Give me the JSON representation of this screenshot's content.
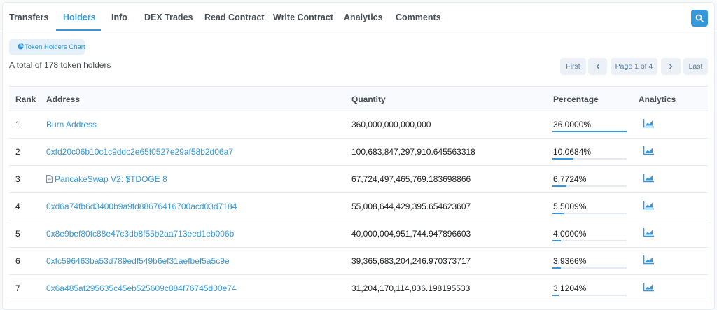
{
  "tabs": [
    {
      "label": "Transfers",
      "active": false
    },
    {
      "label": "Holders",
      "active": true
    },
    {
      "label": "Info",
      "active": false
    },
    {
      "label": "DEX Trades",
      "active": false
    },
    {
      "label": "Read Contract",
      "active": false
    },
    {
      "label": "Write Contract",
      "active": false
    },
    {
      "label": "Analytics",
      "active": false
    },
    {
      "label": "Comments",
      "active": false
    }
  ],
  "chart_button_label": "Token Holders Chart",
  "total_text": "A total of 178 token holders",
  "pagination": {
    "first": "First",
    "prev_icon": "chevron-left-icon",
    "page_info": "Page 1 of 4",
    "next_icon": "chevron-right-icon",
    "last": "Last"
  },
  "table": {
    "headers": [
      "Rank",
      "Address",
      "Quantity",
      "Percentage",
      "Analytics"
    ],
    "rows": [
      {
        "rank": "1",
        "address": "Burn Address",
        "contract": false,
        "quantity": "360,000,000,000,000",
        "percentage": "36.0000%",
        "pct_value": 36.0
      },
      {
        "rank": "2",
        "address": "0xfd20c06b10c1c9ddc2e65f0527e29af58b2d06a7",
        "contract": false,
        "quantity": "100,683,847,297,910.645563318",
        "percentage": "10.0684%",
        "pct_value": 10.0684
      },
      {
        "rank": "3",
        "address": "PancakeSwap V2: $TDOGE 8",
        "contract": true,
        "quantity": "67,724,497,465,769.183698866",
        "percentage": "6.7724%",
        "pct_value": 6.7724
      },
      {
        "rank": "4",
        "address": "0xd6a74fb6d3400b9a9fd88676416700acd03d7184",
        "contract": false,
        "quantity": "55,008,644,429,395.654623607",
        "percentage": "5.5009%",
        "pct_value": 5.5009
      },
      {
        "rank": "5",
        "address": "0x8e9bef80fc88e47c3db8f55b2aa713eed1eb006b",
        "contract": false,
        "quantity": "40,000,004,951,744.947896603",
        "percentage": "4.0000%",
        "pct_value": 4.0
      },
      {
        "rank": "6",
        "address": "0xfc596463ba53d789edf549b6ef31aefbef5a5c9e",
        "contract": false,
        "quantity": "39,365,683,204,246.970373717",
        "percentage": "3.9366%",
        "pct_value": 3.9366
      },
      {
        "rank": "7",
        "address": "0x6a485af295635c45eb525609c884f76745d00e74",
        "contract": false,
        "quantity": "31,204,170,114,836.198195533",
        "percentage": "3.1204%",
        "pct_value": 3.1204
      }
    ]
  },
  "colors": {
    "accent": "#3498db",
    "border": "#e7eaf3",
    "header_bg": "#f8fafd"
  },
  "icons": {
    "search": "search-icon",
    "chart": "pie-chart-icon",
    "analytics": "area-chart-icon",
    "contract": "file-icon"
  }
}
